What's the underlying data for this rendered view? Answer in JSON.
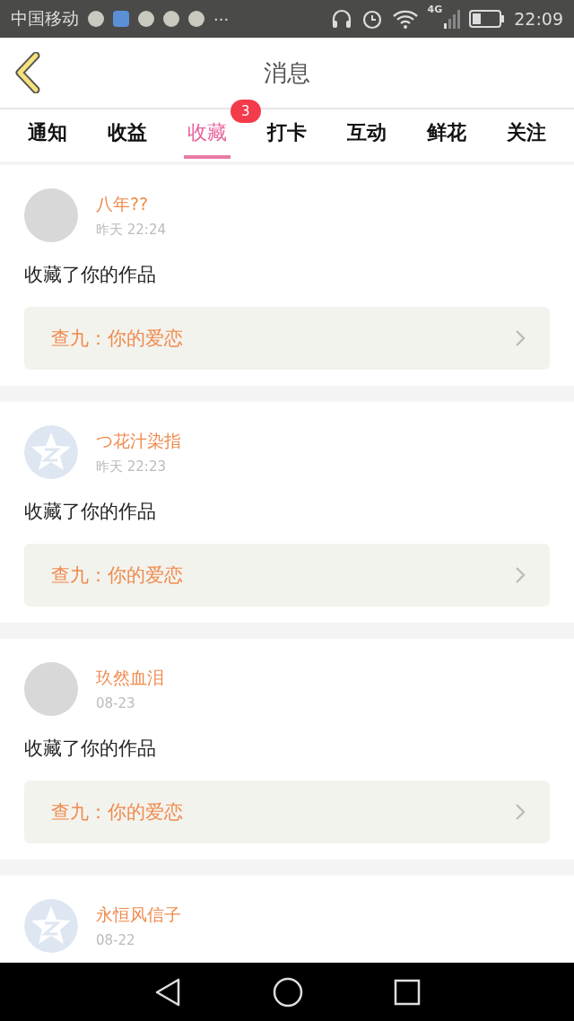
{
  "status_bar": {
    "carrier": "中国移动",
    "more": "···",
    "network": "4G",
    "time": "22:09"
  },
  "header": {
    "title": "消息"
  },
  "tabs": [
    {
      "label": "通知",
      "selected": false
    },
    {
      "label": "收益",
      "selected": false
    },
    {
      "label": "收藏",
      "selected": true,
      "badge": "3"
    },
    {
      "label": "打卡",
      "selected": false
    },
    {
      "label": "互动",
      "selected": false
    },
    {
      "label": "鲜花",
      "selected": false
    },
    {
      "label": "关注",
      "selected": false
    }
  ],
  "messages": [
    {
      "kind": "photo",
      "name": "八年??",
      "time": "昨天 22:24",
      "action": "收藏了你的作品",
      "work": "查九：你的爱恋"
    },
    {
      "kind": "default",
      "name": "つ花汁染指",
      "time": "昨天 22:23",
      "action": "收藏了你的作品",
      "work": "查九：你的爱恋"
    },
    {
      "kind": "photo",
      "name": "玖然血泪",
      "time": "08-23",
      "action": "收藏了你的作品",
      "work": "查九：你的爱恋"
    },
    {
      "kind": "default",
      "name": "永恒风信子",
      "time": "08-22"
    }
  ]
}
